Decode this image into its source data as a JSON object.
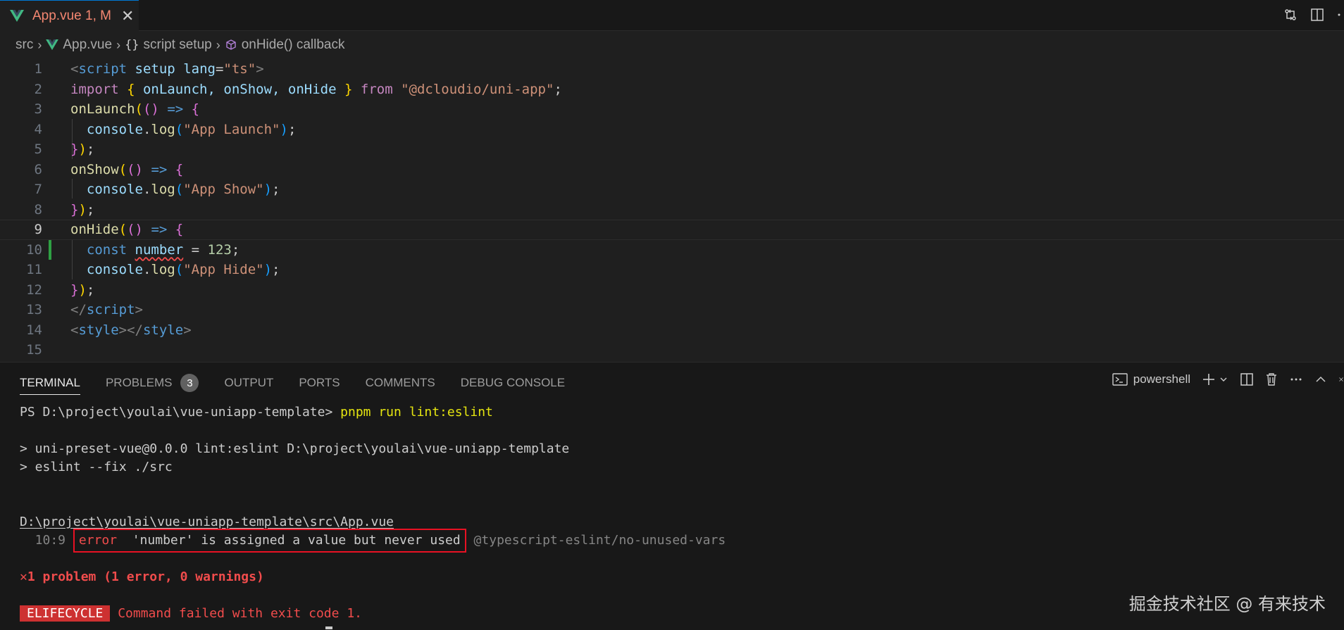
{
  "tab": {
    "title": "App.vue 1, M",
    "close_icon": "close-icon"
  },
  "breadcrumb": {
    "items": [
      "src",
      "App.vue",
      "{}",
      "script setup",
      "onHide() callback"
    ]
  },
  "editor": {
    "lines": [
      {
        "n": "1"
      },
      {
        "n": "2"
      },
      {
        "n": "3"
      },
      {
        "n": "4"
      },
      {
        "n": "5"
      },
      {
        "n": "6"
      },
      {
        "n": "7"
      },
      {
        "n": "8"
      },
      {
        "n": "9"
      },
      {
        "n": "10"
      },
      {
        "n": "11"
      },
      {
        "n": "12"
      },
      {
        "n": "13"
      },
      {
        "n": "14"
      },
      {
        "n": "15"
      }
    ],
    "code": {
      "l1": {
        "open": "<",
        "tag": "script",
        "kw_setup": "setup",
        "attr": "lang",
        "eq": "=",
        "val": "\"ts\"",
        "close": ">"
      },
      "l2": {
        "import": "import",
        "brace_open": "{",
        "names": " onLaunch, onShow, onHide ",
        "brace_close": "}",
        "from": "from",
        "module": "\"@dcloudio/uni-app\"",
        "semi": ";"
      },
      "l3": {
        "fn": "onLaunch",
        "p1": "(",
        "p2": "()",
        "arrow": "=>",
        "brace": "{"
      },
      "l4": {
        "obj": "console",
        "dot": ".",
        "fn": "log",
        "p_open": "(",
        "str": "\"App Launch\"",
        "p_close": ")",
        "semi": ";"
      },
      "l5": {
        "brace": "}",
        "paren": ")",
        "semi": ";"
      },
      "l6": {
        "fn": "onShow",
        "p1": "(",
        "p2": "()",
        "arrow": "=>",
        "brace": "{"
      },
      "l7": {
        "obj": "console",
        "dot": ".",
        "fn": "log",
        "p_open": "(",
        "str": "\"App Show\"",
        "p_close": ")",
        "semi": ";"
      },
      "l8": {
        "brace": "}",
        "paren": ")",
        "semi": ";"
      },
      "l9": {
        "fn": "onHide",
        "p1": "(",
        "p2": "()",
        "arrow": "=>",
        "brace": "{"
      },
      "l10": {
        "const": "const",
        "var": "number",
        "eq": " = ",
        "num": "123",
        "semi": ";"
      },
      "l11": {
        "obj": "console",
        "dot": ".",
        "fn": "log",
        "p_open": "(",
        "str": "\"App Hide\"",
        "p_close": ")",
        "semi": ";"
      },
      "l12": {
        "brace": "}",
        "paren": ")",
        "semi": ";"
      },
      "l13": {
        "open": "</",
        "tag": "script",
        "close": ">"
      },
      "l14": {
        "open1": "<",
        "tag1": "style",
        "mid": "></",
        "tag2": "style",
        "close": ">"
      }
    }
  },
  "panel": {
    "tabs": [
      "TERMINAL",
      "PROBLEMS",
      "OUTPUT",
      "PORTS",
      "COMMENTS",
      "DEBUG CONSOLE"
    ],
    "problems_count": "3",
    "shell": "powershell"
  },
  "terminal": {
    "prompt": "PS D:\\project\\youlai\\vue-uniapp-template> ",
    "command": "pnpm run lint:eslint",
    "script_line1": "> uni-preset-vue@0.0.0 lint:eslint D:\\project\\youlai\\vue-uniapp-template",
    "script_line2": "> eslint --fix ./src",
    "file_path": "D:\\project\\youlai\\vue-uniapp-template\\src\\App.vue",
    "location": "  10:9 ",
    "error_word": "error",
    "error_message": "  'number' is assigned a value but never used",
    "rule": " @typescript-eslint/no-unused-vars",
    "summary_icon": "✕",
    "summary": "1 problem (1 error, 0 warnings)",
    "elifecycle": "ELIFECYCLE",
    "failure": " Command failed with exit code 1."
  },
  "watermark": "掘金技术社区 @ 有来技术"
}
